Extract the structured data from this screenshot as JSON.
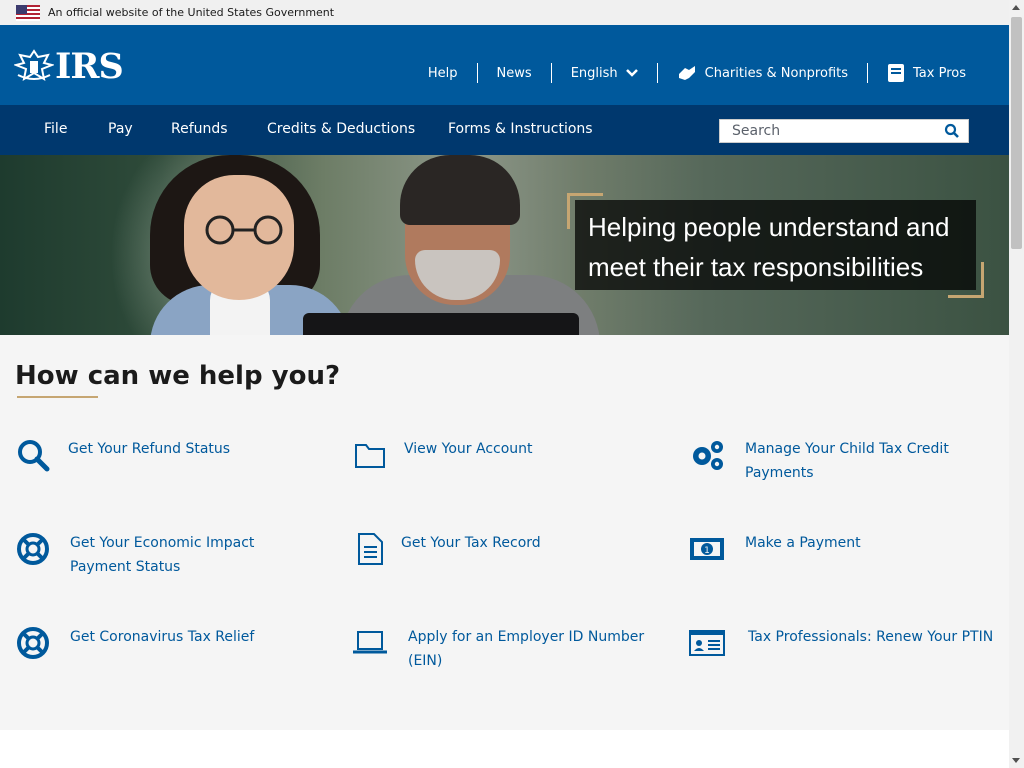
{
  "gov_banner": {
    "text": "An official website of the United States Government"
  },
  "header": {
    "logo_text": "IRS",
    "links": [
      "Help",
      "News",
      "English",
      "Charities & Nonprofits",
      "Tax Pros"
    ]
  },
  "main_nav": {
    "items": [
      "File",
      "Pay",
      "Refunds",
      "Credits & Deductions",
      "Forms & Instructions"
    ],
    "search_placeholder": "Search"
  },
  "hero": {
    "line1": "Helping people understand and",
    "line2": "meet their tax responsibilities"
  },
  "help": {
    "title": "How can we help you?",
    "tiles": [
      {
        "label": "Get Your Refund Status",
        "icon": "search-icon"
      },
      {
        "label": "View Your Account",
        "icon": "folder-icon"
      },
      {
        "label": "Manage Your Child Tax Credit Payments",
        "icon": "gears-icon"
      },
      {
        "label": "Get Your Economic Impact Payment Status",
        "icon": "lifebuoy-icon"
      },
      {
        "label": "Get Your Tax Record",
        "icon": "document-icon"
      },
      {
        "label": "Make a Payment",
        "icon": "money-icon"
      },
      {
        "label": "Get Coronavirus Tax Relief",
        "icon": "lifebuoy-icon"
      },
      {
        "label": "Apply for an Employer ID Number (EIN)",
        "icon": "laptop-icon"
      },
      {
        "label": "Tax Professionals: Renew Your PTIN",
        "icon": "id-card-icon"
      }
    ]
  },
  "colors": {
    "header": "#00599c",
    "nav": "#00386e",
    "accent": "#c6a672",
    "link": "#00599c"
  }
}
